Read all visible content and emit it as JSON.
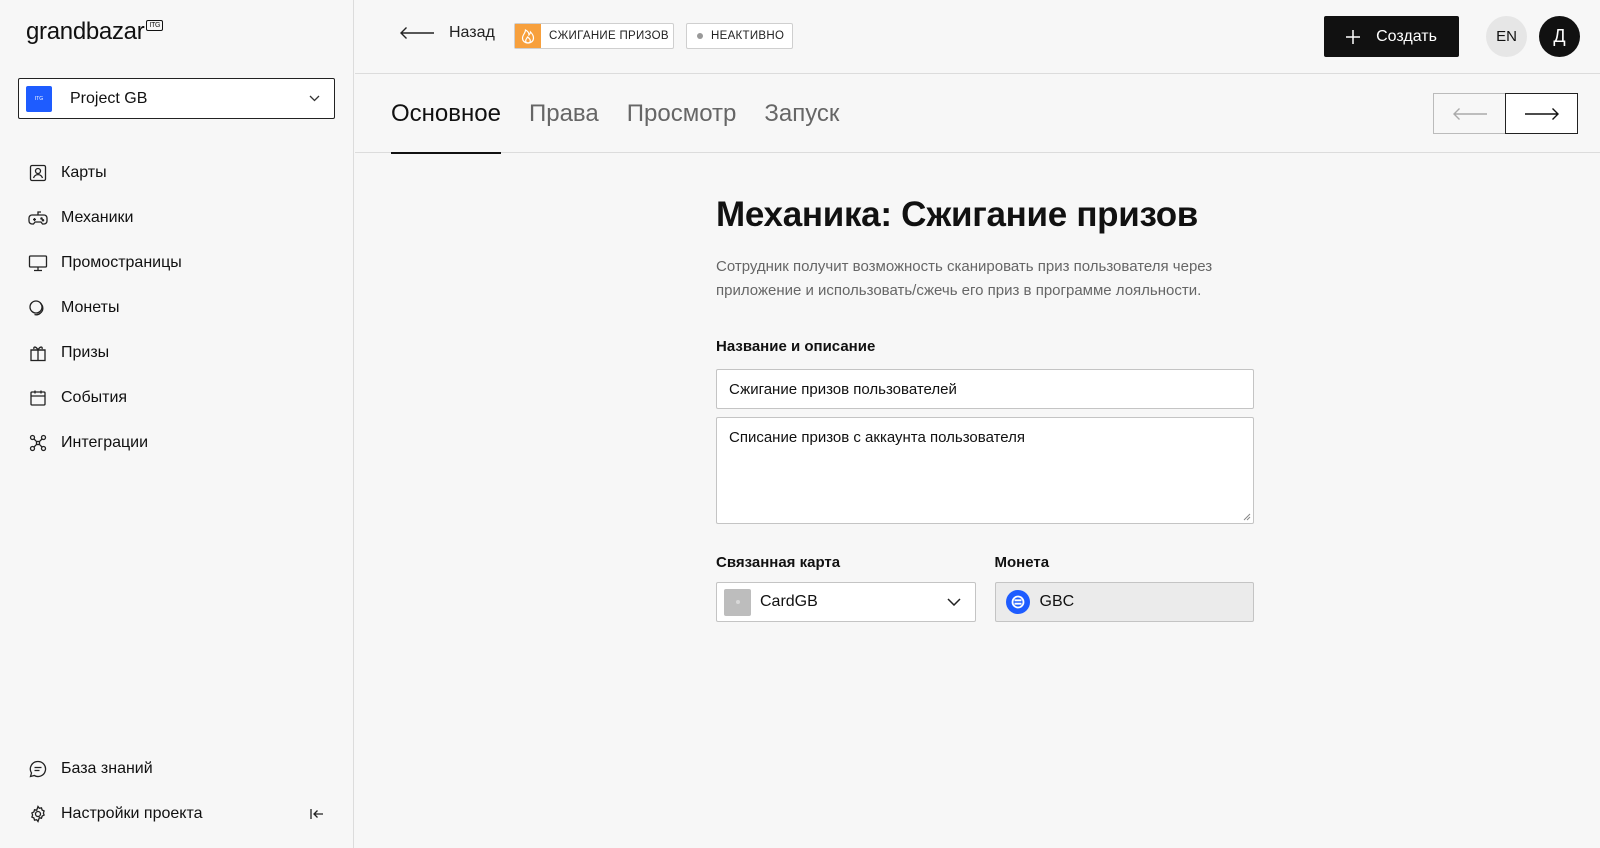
{
  "logo": {
    "text": "grandbazar",
    "badge": "ITG"
  },
  "project": {
    "name": "Project GB",
    "icon_text": "ITG"
  },
  "sidebar": {
    "items": [
      {
        "label": "Карты",
        "icon": "id-card-icon"
      },
      {
        "label": "Механики",
        "icon": "gamepad-icon"
      },
      {
        "label": "Промостраницы",
        "icon": "monitor-icon"
      },
      {
        "label": "Монеты",
        "icon": "coins-icon"
      },
      {
        "label": "Призы",
        "icon": "gift-icon"
      },
      {
        "label": "События",
        "icon": "calendar-icon"
      },
      {
        "label": "Интеграции",
        "icon": "integrations-icon"
      }
    ],
    "bottom": [
      {
        "label": "База знаний",
        "icon": "chat-icon"
      },
      {
        "label": "Настройки проекта",
        "icon": "gear-icon"
      }
    ]
  },
  "header": {
    "back_label": "Назад",
    "mechanic_tag": "СЖИГАНИЕ ПРИЗОВ",
    "status_tag": "НЕАКТИВНО",
    "create_label": "Создать",
    "lang": "EN",
    "avatar_letter": "Д"
  },
  "tabs": [
    {
      "label": "Основное",
      "active": true
    },
    {
      "label": "Права",
      "active": false
    },
    {
      "label": "Просмотр",
      "active": false
    },
    {
      "label": "Запуск",
      "active": false
    }
  ],
  "main": {
    "title": "Механика: Сжигание призов",
    "description": "Сотрудник получит возможность сканировать приз пользователя через приложение и использовать/сжечь его приз в программе лояльности.",
    "name_section_label": "Название и описание",
    "name_value": "Сжигание призов пользователей",
    "description_value": "Списание призов с аккаунта пользователя",
    "linked_card_label": "Связанная карта",
    "linked_card_value": "CardGB",
    "coin_label": "Монета",
    "coin_value": "GBC"
  },
  "colors": {
    "accent_blue": "#1e5cff",
    "burn_orange": "#f7a03d",
    "primary_button": "#111111"
  }
}
